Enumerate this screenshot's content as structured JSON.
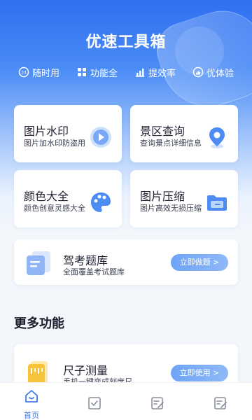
{
  "header": {
    "title": "优速工具箱",
    "features": [
      {
        "label": "随时用",
        "icon": "clock-24-icon"
      },
      {
        "label": "功能全",
        "icon": "grid-icon"
      },
      {
        "label": "提效率",
        "icon": "bar-chart-icon"
      },
      {
        "label": "优体验",
        "icon": "thumbs-up-icon"
      }
    ]
  },
  "cards": [
    {
      "title": "图片水印",
      "subtitle": "图片加水印防盗用",
      "icon": "watermark-play-icon"
    },
    {
      "title": "景区查询",
      "subtitle": "查询景点详细信息",
      "icon": "location-pin-icon"
    },
    {
      "title": "颜色大全",
      "subtitle": "颜色创意灵感大全",
      "icon": "palette-icon"
    },
    {
      "title": "图片压缩",
      "subtitle": "图片高效无损压缩",
      "icon": "folder-icon"
    }
  ],
  "exam": {
    "title": "驾考题库",
    "subtitle": "全面覆盖考试题库",
    "button": "立即做题 >",
    "icon": "document-stack-icon"
  },
  "more": {
    "title": "更多功能",
    "items": [
      {
        "title": "尺子测量",
        "subtitle": "手机一键变成刻度尺",
        "button": "立即使用 >",
        "icon": "ruler-icon"
      }
    ]
  },
  "tabbar": {
    "tabs": [
      {
        "label": "首页",
        "icon": "home-icon",
        "active": true
      },
      {
        "label": "",
        "icon": "check-square-icon",
        "active": false
      },
      {
        "label": "",
        "icon": "edit-note-icon",
        "active": false
      },
      {
        "label": "",
        "icon": "edit-note-icon",
        "active": false
      }
    ]
  },
  "colors": {
    "primary": "#3f7bf0",
    "button": "#7fb0f6",
    "background": "#f3f6fb"
  }
}
